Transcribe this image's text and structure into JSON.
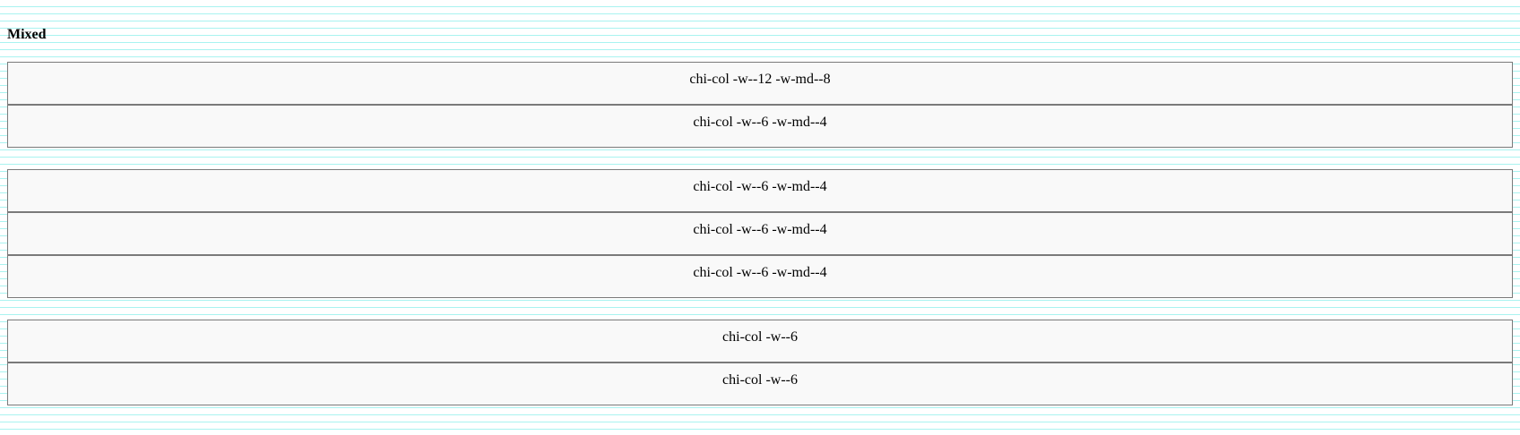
{
  "page": {
    "title": "Mixed"
  },
  "grids": [
    {
      "columns": [
        {
          "label": "chi-col -w--12 -w-md--8"
        },
        {
          "label": "chi-col -w--6 -w-md--4"
        }
      ]
    },
    {
      "columns": [
        {
          "label": "chi-col -w--6 -w-md--4"
        },
        {
          "label": "chi-col -w--6 -w-md--4"
        },
        {
          "label": "chi-col -w--6 -w-md--4"
        }
      ]
    },
    {
      "columns": [
        {
          "label": "chi-col -w--6"
        },
        {
          "label": "chi-col -w--6"
        }
      ]
    }
  ],
  "colors": {
    "grid_line": "#a9f3f0",
    "column_background": "#f9f9f9",
    "column_border": "#7a7a7a"
  }
}
